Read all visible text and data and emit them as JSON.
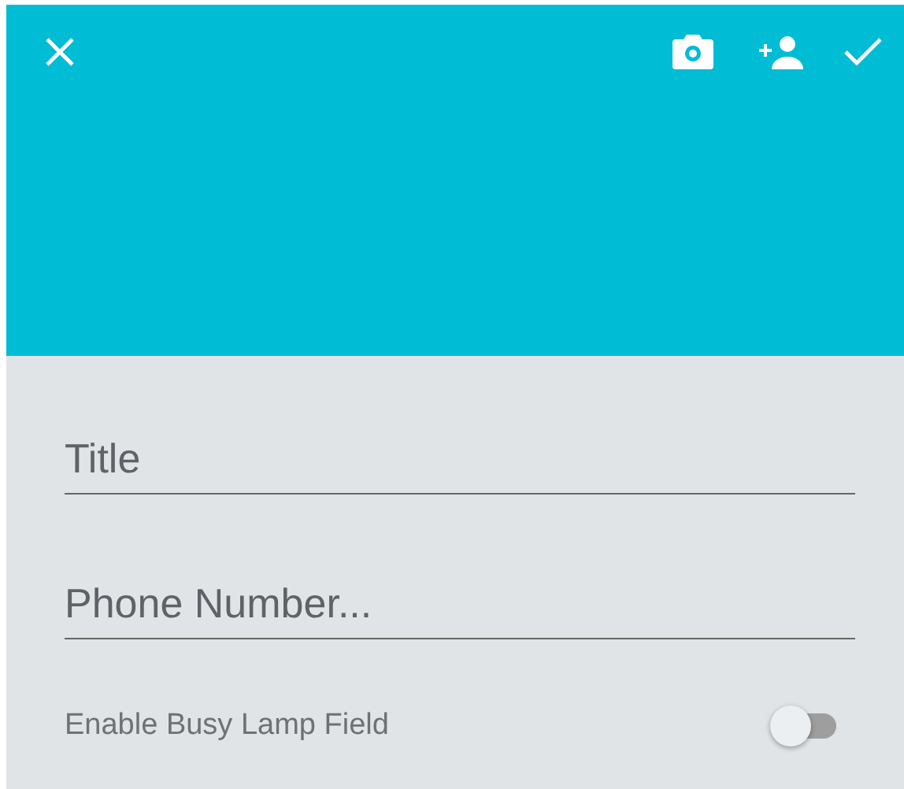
{
  "toolbar": {
    "actions": [
      {
        "kind": "close"
      },
      {
        "kind": "camera"
      },
      {
        "kind": "add-person"
      },
      {
        "kind": "confirm"
      }
    ]
  },
  "fields": [
    {
      "placeholder": "Title"
    },
    {
      "placeholder": "Phone Number..."
    }
  ],
  "toggle": {
    "label": "Enable Busy Lamp Field",
    "on": false
  }
}
